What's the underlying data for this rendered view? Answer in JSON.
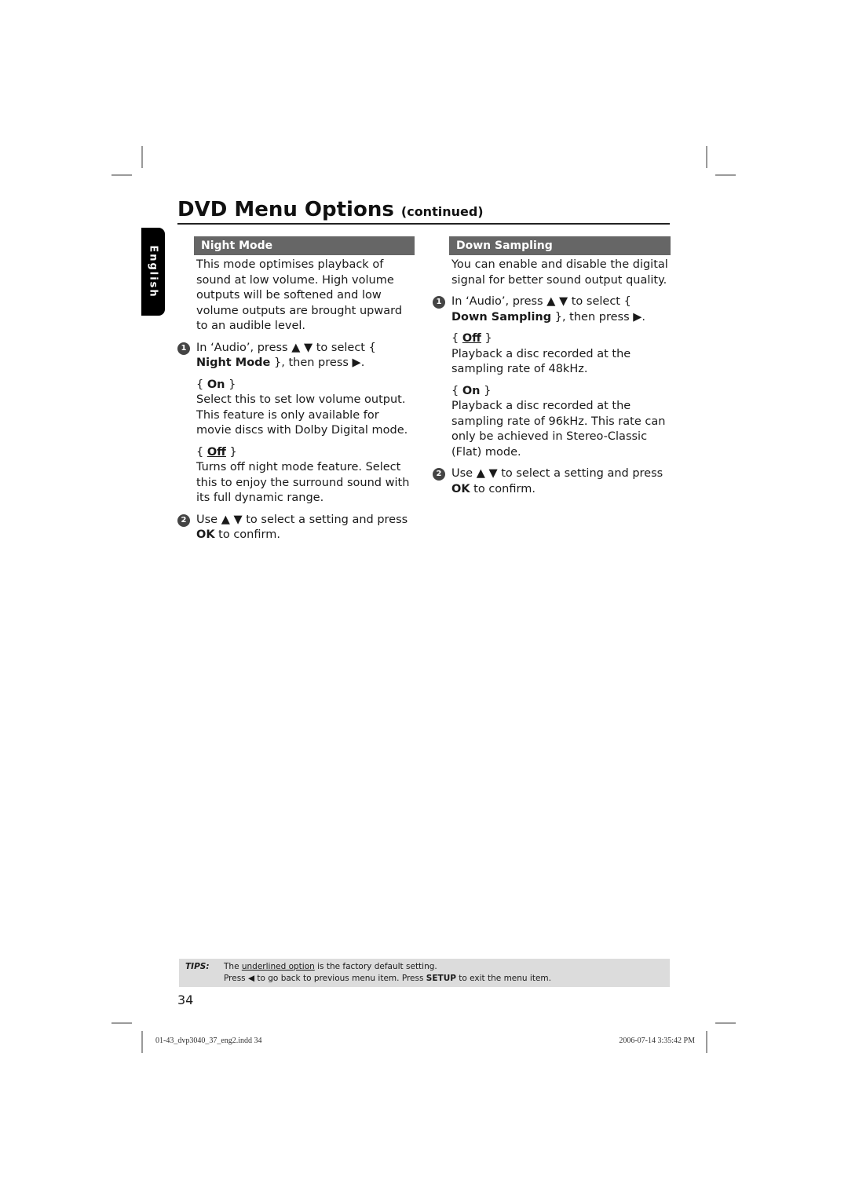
{
  "header": {
    "title": "DVD Menu Options",
    "continued": "(continued)"
  },
  "language_tab": "English",
  "night_mode": {
    "heading": "Night Mode",
    "intro": "This mode optimises playback of sound at low volume. High volume outputs will be softened and low volume outputs are brought upward to an audible level.",
    "step1": {
      "num": "1",
      "pre": "In ‘Audio’, press ▲ ▼ to select { ",
      "bold": "Night Mode",
      "post": " }, then press ▶."
    },
    "options": [
      {
        "label": "On",
        "default": false,
        "desc": "Select this to set low volume output. This feature is only available for movie discs with Dolby Digital mode."
      },
      {
        "label": "Off",
        "default": true,
        "desc": "Turns off night mode feature. Select this to enjoy the surround sound with its full dynamic range."
      }
    ],
    "step2": {
      "num": "2",
      "pre": "Use ▲ ▼ to select a setting and press ",
      "bold": "OK",
      "post": " to confirm."
    }
  },
  "down_sampling": {
    "heading": "Down Sampling",
    "intro": "You can enable and disable the digital signal for better sound output quality.",
    "step1": {
      "num": "1",
      "pre": "In ‘Audio’, press ▲ ▼ to select { ",
      "bold": "Down Sampling",
      "post": " }, then press ▶."
    },
    "options": [
      {
        "label": "Off",
        "default": true,
        "desc": "Playback a disc recorded at the sampling rate of 48kHz."
      },
      {
        "label": "On",
        "default": false,
        "desc": "Playback a disc recorded at the sampling rate of 96kHz. This rate can only be achieved in Stereo-Classic (Flat) mode."
      }
    ],
    "step2": {
      "num": "2",
      "pre": "Use ▲ ▼ to select a setting and press ",
      "bold": "OK",
      "post": " to confirm."
    }
  },
  "tips": {
    "label": "TIPS:",
    "line1_pre": "The ",
    "line1_u": "underlined option",
    "line1_post": " is the factory default setting.",
    "line2_pre": "Press  ◀ to go back to previous menu item. Press ",
    "line2_bold": "SETUP",
    "line2_post": " to exit the menu item."
  },
  "page_number": "34",
  "slug": {
    "file": "01-43_dvp3040_37_eng2.indd   34",
    "date": "2006-07-14   3:35:42 PM"
  }
}
